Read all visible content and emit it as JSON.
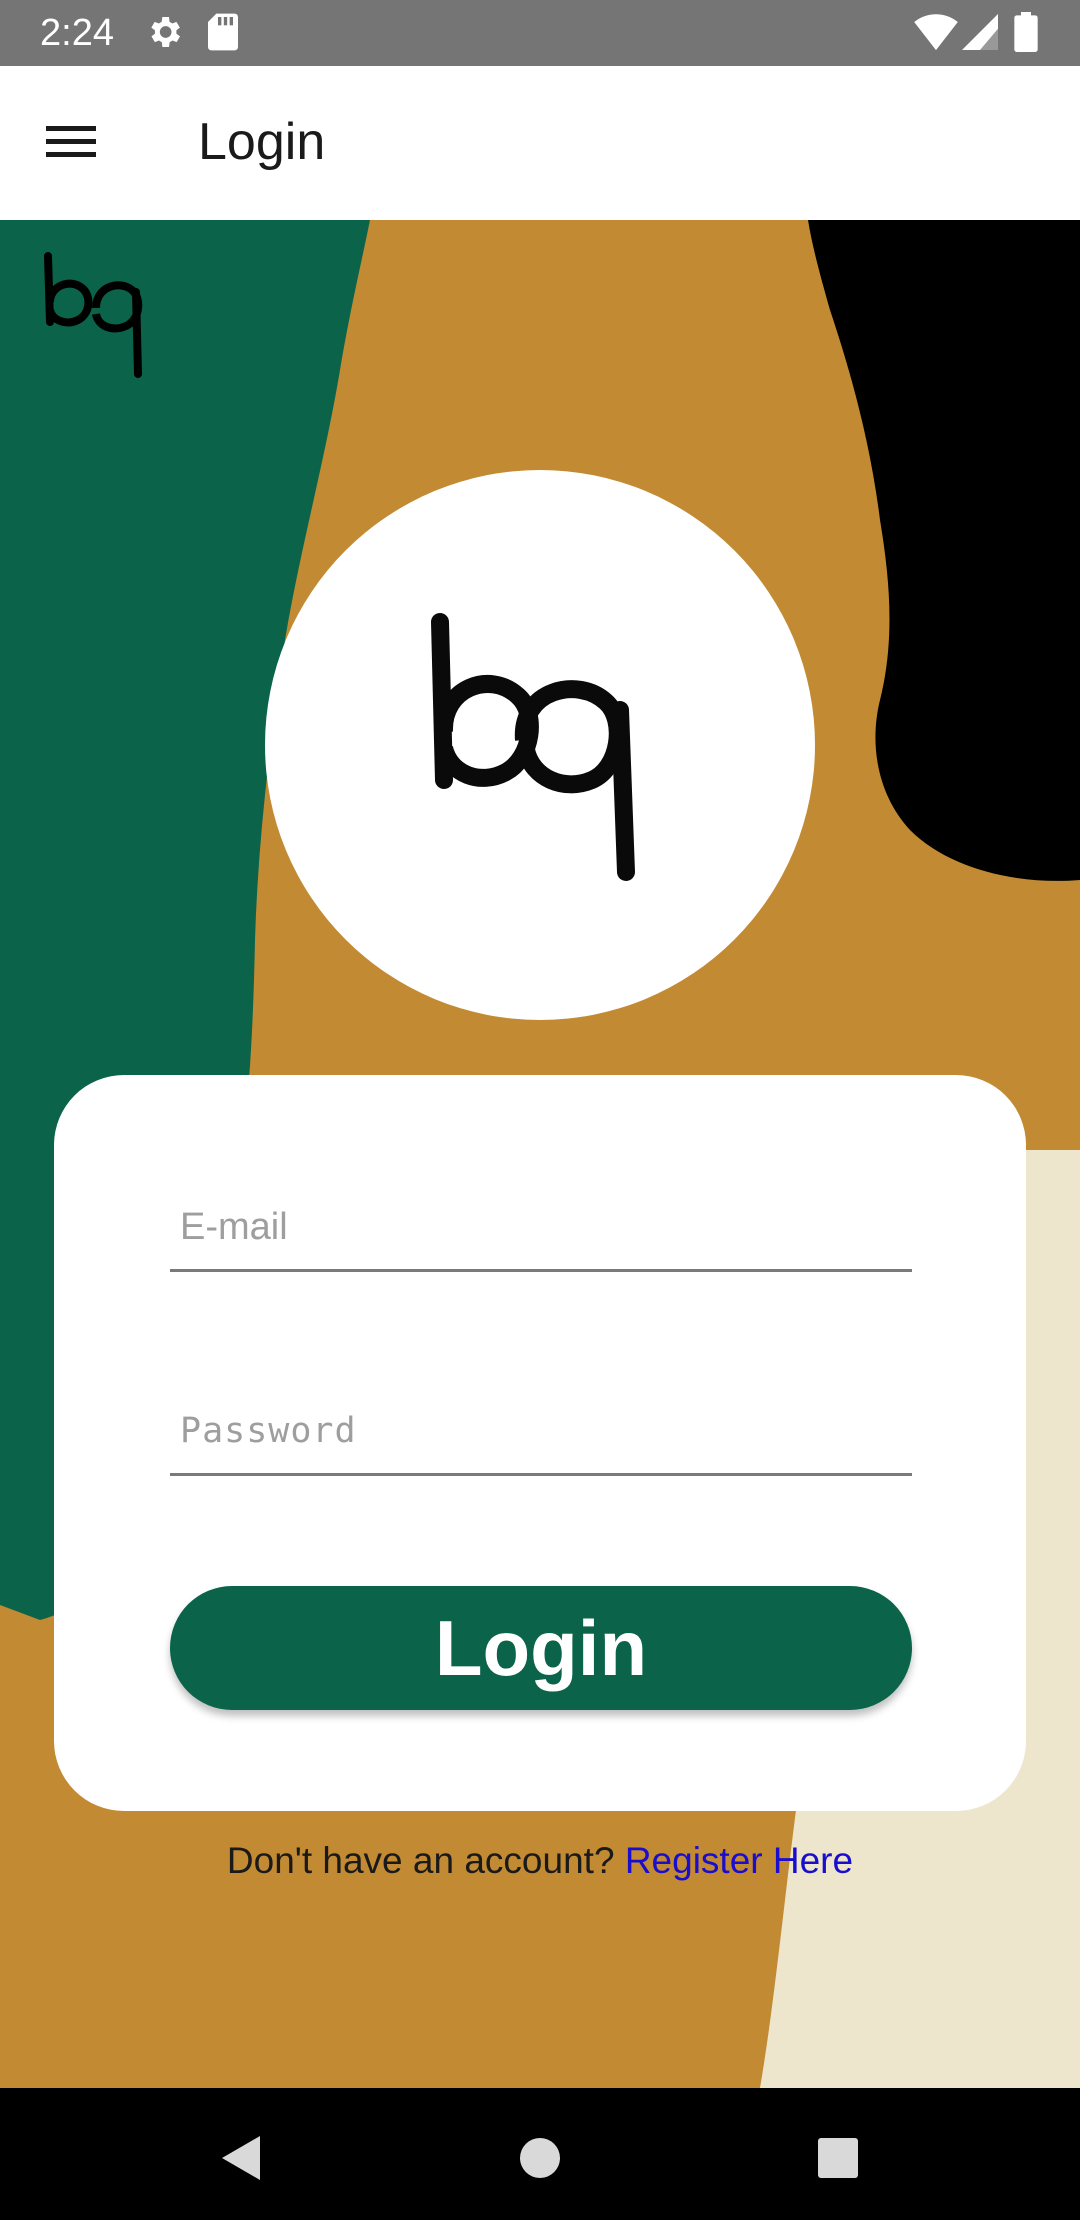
{
  "status_bar": {
    "time": "2:24"
  },
  "app_bar": {
    "title": "Login",
    "menu_icon": "hamburger-menu-icon"
  },
  "colors": {
    "brand_green": "#0b644a",
    "mustard": "#c28a33",
    "cream": "#ede6cc",
    "link_blue": "#1a0dcc"
  },
  "logo": {
    "icon": "bq-logo-icon"
  },
  "form": {
    "email_placeholder": "E-mail",
    "password_placeholder": "Password",
    "login_button": "Login"
  },
  "register": {
    "prompt": "Don't have an account? ",
    "link": "Register Here"
  },
  "nav_bar": {
    "back_icon": "back-triangle-icon",
    "home_icon": "home-circle-icon",
    "recents_icon": "recents-square-icon"
  }
}
